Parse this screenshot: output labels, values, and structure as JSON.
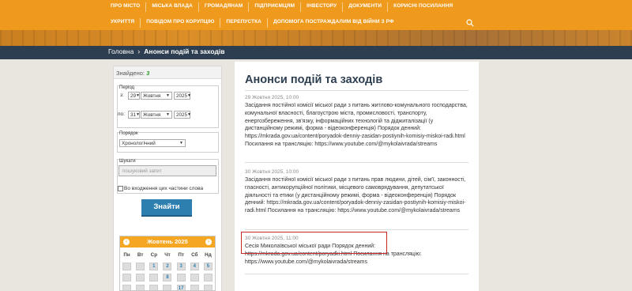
{
  "nav": {
    "row1": [
      "Про місто",
      "Міська влада",
      "Громадянам",
      "Підприємцям",
      "Інвестору",
      "Документи",
      "Корисні посилання"
    ],
    "row2": [
      "Укриття",
      "Повідом про корупцію",
      "Перепустка",
      "Допомога постраждалим від війни з РФ"
    ]
  },
  "breadcrumb": {
    "home": "Головна",
    "current": "Анонси подій та заходів"
  },
  "sidebar": {
    "found_label": "Знайдено:",
    "found_count": "3",
    "period_label": "Період",
    "from_label": "з:",
    "from_day": "29",
    "from_month": "Жовтня",
    "from_year": "2025",
    "to_label": "по:",
    "to_day": "31",
    "to_month": "Жовтня",
    "to_year": "2025",
    "order_label": "Порядок",
    "order_value": "Хронологічний",
    "search_label": "Шукати",
    "search_placeholder": "пошуковий запит",
    "exact_label": "Во входження цих частини слова",
    "submit_label": "Знайти"
  },
  "calendar": {
    "title": "Жовтень 2025",
    "prev": "‹",
    "next": "›",
    "days": [
      "Пн",
      "Вт",
      "Ср",
      "Чт",
      "Пт",
      "Сб",
      "Нд"
    ],
    "row1": [
      "",
      "",
      "1",
      "2",
      "3",
      "4",
      "5"
    ],
    "row2": [
      "",
      "",
      "",
      "8",
      "",
      "",
      ""
    ],
    "row3": [
      "",
      "",
      "",
      "",
      "17",
      "",
      ""
    ]
  },
  "main": {
    "title": "Анонси подій та заходів",
    "events": [
      {
        "date": "29 Жовтня 2025, 10:00",
        "text": "Засідання постійної комісії міської ради з питань житлово-комунального господарства, комунальної власності, благоустрою міста, промисловості, транспорту, енергозбереження, зв'язку, інформаційних технологій та діджиталізації (у дистанційному режимі, форма - відеоконференція) Порядок денний: https://mkrada.gov.ua/content/poryadok-denniy-zasidan-postiynih-komisiy-miskoi-radi.html Посилання на трансляцію: https://www.youtube.com/@mykolaivrada/streams"
      },
      {
        "date": "30 Жовтня 2025, 10:00",
        "text": "Засідання постійної комісії міської ради з питань прав людини, дітей, сім'ї, законності, гласності, антикорупційної політики, місцевого самоврядування, депутатської діяльності та етики (у дистанційному режимі, форма - відеоконференція) Порядок денний: https://mkrada.gov.ua/content/poryadok-denniy-zasidan-postiynih-komisiy-miskoi-radi.html Посилання на трансляцію: https://www.youtube.com/@mykolaivrada/streams"
      },
      {
        "date": "30 Жовтня 2025, 11:00",
        "text": "Сесія Миколаївської міської ради Порядок денний: https://mkrada.gov.ua/content/poryadki.html Посилання на трансляцію: https://www.youtube.com/@mykolaivrada/streams"
      }
    ]
  },
  "colors": {
    "header": "#ef9a1c",
    "breadcrumb": "#2c3e4f",
    "button": "#2d7fb0",
    "calendar_head": "#f5a623",
    "highlight": "#c62828"
  }
}
